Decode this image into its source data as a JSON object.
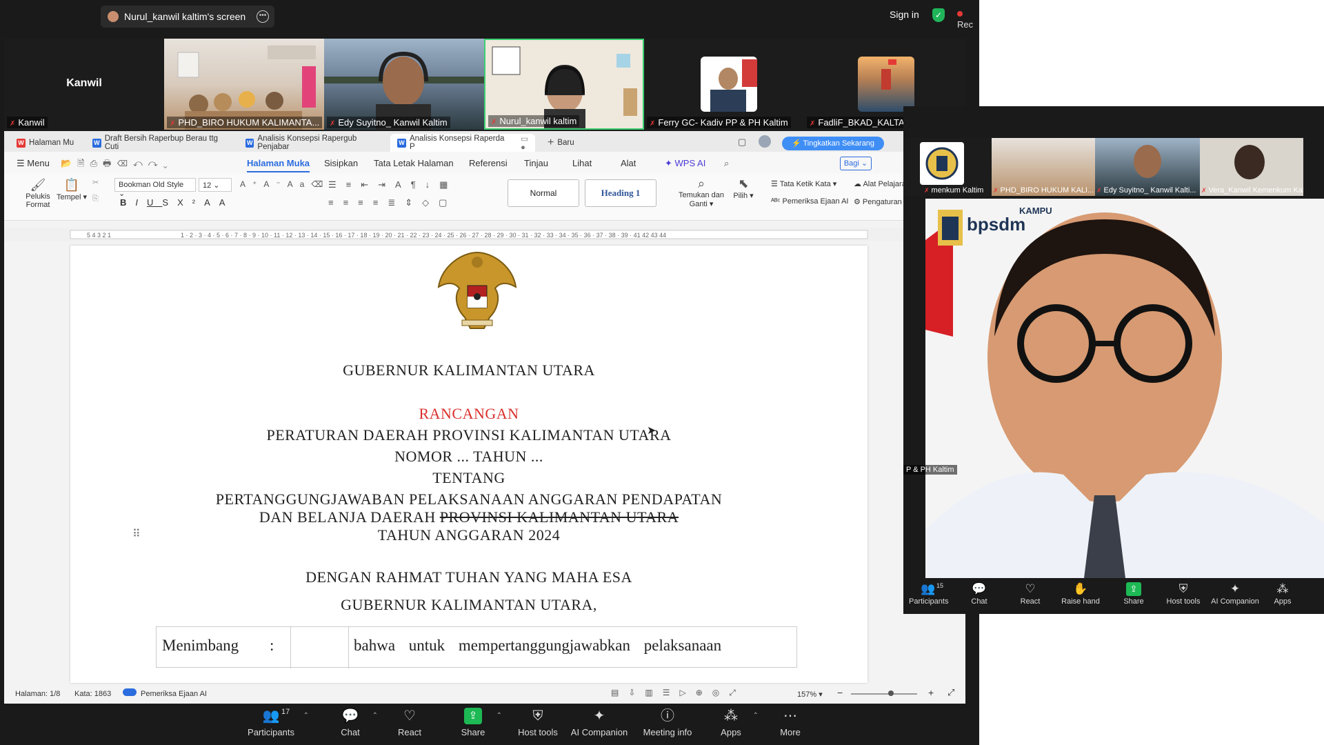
{
  "meeting": {
    "share_title": "Nurul_kanwil kaltim's screen",
    "sign_in": "Sign in",
    "recording": "Rec",
    "gallery": [
      {
        "name": "Kanwil",
        "label": "Kanwil"
      },
      {
        "name": "PHD_BIRO HUKUM KALIMANTA..."
      },
      {
        "name": "Edy Suyitno_ Kanwil Kaltim"
      },
      {
        "name": "Nurul_kanwil kaltim"
      },
      {
        "name": "Ferry GC- Kadiv PP & PH Kaltim"
      },
      {
        "name": "FadliF_BKAD_KALTAR"
      }
    ]
  },
  "doc": {
    "tabs": [
      "Halaman Mu",
      "Draft Bersih Raperbup Berau ttg Cuti",
      "Analisis Konsepsi Rapergub Penjabar",
      "Analisis Konsepsi Raperda P",
      "Baru"
    ],
    "upgrade": "Tingkatkan Sekarang",
    "menu_label": "Menu",
    "menu_tabs": [
      "Halaman Muka",
      "Sisipkan",
      "Tata Letak Halaman",
      "Referensi",
      "Tinjau",
      "Lihat",
      "Alat",
      "WPS AI"
    ],
    "share": "Bagi",
    "ribbon": {
      "format_painter": "Pelukis Format",
      "paste": "Tempel",
      "font": "Bookman Old Style",
      "size": "12",
      "style_normal": "Normal",
      "style_heading": "Heading 1",
      "find_replace": "Temukan dan Ganti",
      "select": "Pilih",
      "typing": "Tata Ketik Kata",
      "spell": "Pemeriksa Ejaan AI",
      "learn": "Alat Pelajaran",
      "settings": "Pengaturan"
    },
    "page": {
      "line1": "GUBERNUR KALIMANTAN UTARA",
      "line2": "RANCANGAN",
      "line3": "PERATURAN DAERAH PROVINSI KALIMANTAN UTARA",
      "line4": "NOMOR ... TAHUN ...",
      "line5": "TENTANG",
      "line6": "PERTANGGUNGJAWABAN PELAKSANAAN ANGGARAN PENDAPATAN",
      "line7a": "DAN BELANJA DAERAH ",
      "line7b": "PROVINSI KALIMANTAN UTARA",
      "line8": "TAHUN ANGGARAN 2024",
      "line9": "DENGAN RAHMAT TUHAN YANG MAHA ESA",
      "line10": "GUBERNUR KALIMANTAN UTARA,",
      "table_c1": "Menimbang",
      "table_c2": ":",
      "table_c4": "bahwa untuk mempertanggungjawabkan pelaksanaan"
    },
    "status": {
      "page": "Halaman: 1/8",
      "words": "Kata: 1863",
      "spell": "Pemeriksa Ejaan AI",
      "zoom": "157%"
    }
  },
  "toolbar": {
    "participants": "Participants",
    "participants_count": "17",
    "chat": "Chat",
    "react": "React",
    "share": "Share",
    "host_tools": "Host tools",
    "ai_companion": "AI Companion",
    "meeting_info": "Meeting info",
    "apps": "Apps",
    "more": "More"
  },
  "side": {
    "strip": [
      {
        "name": "menkum Kaltim"
      },
      {
        "name": "PHD_BIRO HUKUM KALI..."
      },
      {
        "name": "Edy Suyitno_ Kanwil Kalti..."
      },
      {
        "name": "Vera_Kanwil Kemenkum Kal..."
      }
    ],
    "speaker_label": "P & PH Kaltim",
    "banner_text": "bpsdm",
    "banner_kamp": "KAMPU",
    "participants_count": "15",
    "bar": [
      "Participants",
      "Chat",
      "React",
      "Raise hand",
      "Share",
      "Host tools",
      "AI Companion",
      "Apps"
    ]
  },
  "colors": {
    "accent": "#2b6cde",
    "red_text": "#d9302c",
    "zoom_bg": "#1a1a1a",
    "share_green": "#1db954"
  }
}
